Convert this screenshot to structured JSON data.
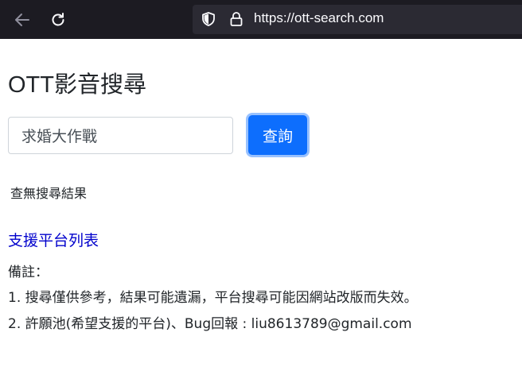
{
  "browser": {
    "url": "https://ott-search.com",
    "icons": [
      "back-arrow-icon",
      "reload-icon",
      "shield-icon",
      "lock-icon"
    ]
  },
  "page": {
    "title": "OTT影音搜尋"
  },
  "search": {
    "value": "求婚大作戰",
    "button_label": "查詢",
    "result_text": "查無搜尋結果"
  },
  "links": {
    "platform_list": "支援平台列表"
  },
  "notes": {
    "title": "備註：",
    "line1": "1. 搜尋僅供參考，結果可能遺漏，平台搜尋可能因網站改版而失效。",
    "line2": "2. 許願池(希望支援的平台)、Bug回報 : liu8613789@gmail.com"
  },
  "colors": {
    "browser_bg": "#1c1b22",
    "urlbar_bg": "#2b2a33",
    "button_primary": "#0d6efd",
    "link": "#0000cc"
  }
}
